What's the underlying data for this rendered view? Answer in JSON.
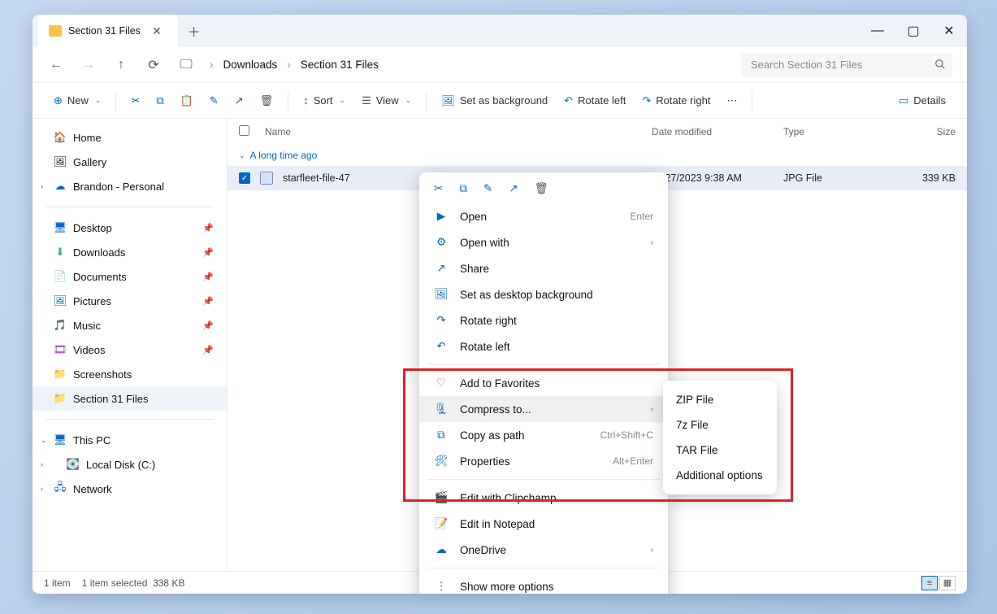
{
  "tab": {
    "title": "Section 31 Files"
  },
  "breadcrumb": {
    "items": [
      "Downloads",
      "Section 31 Files"
    ]
  },
  "search": {
    "placeholder": "Search Section 31 Files"
  },
  "toolbar": {
    "new": "New",
    "sort": "Sort",
    "view": "View",
    "set_bg": "Set as background",
    "rotate_left": "Rotate left",
    "rotate_right": "Rotate right",
    "details": "Details"
  },
  "sidebar": {
    "home": "Home",
    "gallery": "Gallery",
    "personal": "Brandon - Personal",
    "desktop": "Desktop",
    "downloads": "Downloads",
    "documents": "Documents",
    "pictures": "Pictures",
    "music": "Music",
    "videos": "Videos",
    "screenshots": "Screenshots",
    "section31": "Section 31 Files",
    "thispc": "This PC",
    "localdisk": "Local Disk (C:)",
    "network": "Network"
  },
  "columns": {
    "name": "Name",
    "date": "Date modified",
    "type": "Type",
    "size": "Size"
  },
  "group": "A long time ago",
  "file": {
    "name": "starfleet-file-47",
    "date": "11/27/2023 9:38 AM",
    "type": "JPG File",
    "size": "339 KB"
  },
  "context": {
    "open": "Open",
    "open_hint": "Enter",
    "open_with": "Open with",
    "share": "Share",
    "set_desktop": "Set as desktop background",
    "rotate_right": "Rotate right",
    "rotate_left": "Rotate left",
    "favorites": "Add to Favorites",
    "compress": "Compress to...",
    "copy_path": "Copy as path",
    "copy_path_hint": "Ctrl+Shift+C",
    "properties": "Properties",
    "properties_hint": "Alt+Enter",
    "clipchamp": "Edit with Clipchamp",
    "notepad": "Edit in Notepad",
    "onedrive": "OneDrive",
    "more": "Show more options"
  },
  "submenu": {
    "zip": "ZIP File",
    "sevenz": "7z File",
    "tar": "TAR File",
    "additional": "Additional options"
  },
  "status": {
    "count": "1 item",
    "selected": "1 item selected",
    "size": "338 KB"
  }
}
